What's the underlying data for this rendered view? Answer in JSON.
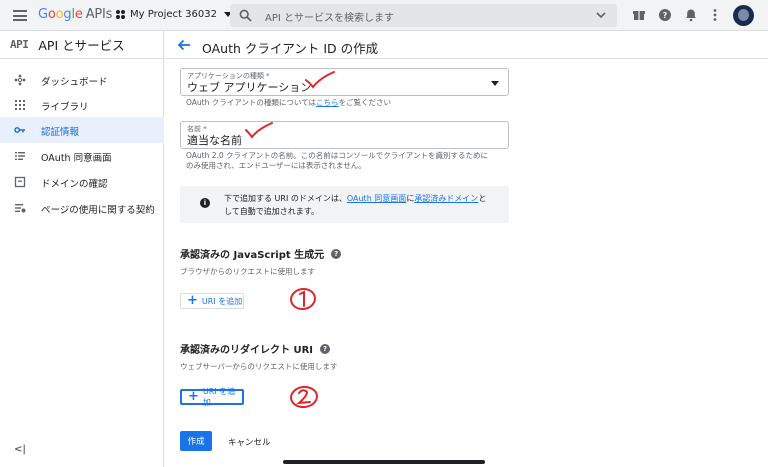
{
  "topbar": {
    "logo_parts": [
      "G",
      "o",
      "o",
      "g",
      "l",
      "e"
    ],
    "logo_suffix": "APIs",
    "project_name": "My Project 36032",
    "search_placeholder": "API とサービスを検索します",
    "icons": [
      "menu-icon",
      "project-dots-icon",
      "search-icon",
      "chevron-down-icon",
      "gift-icon",
      "help-icon",
      "bell-icon",
      "more-vert-icon",
      "avatar"
    ]
  },
  "sidebar": {
    "logo": "API",
    "title": "API とサービス",
    "items": [
      {
        "label": "ダッシュボード",
        "icon": "dashboard-icon",
        "active": false
      },
      {
        "label": "ライブラリ",
        "icon": "library-icon",
        "active": false
      },
      {
        "label": "認証情報",
        "icon": "key-icon",
        "active": true
      },
      {
        "label": "OAuth 同意画面",
        "icon": "consent-icon",
        "active": false
      },
      {
        "label": "ドメインの確認",
        "icon": "domain-check-icon",
        "active": false
      },
      {
        "label": "ページの使用に関する契約",
        "icon": "page-settings-icon",
        "active": false
      }
    ],
    "collapse_label": "<|"
  },
  "header": {
    "title": "OAuth クライアント ID の作成"
  },
  "form": {
    "app_type": {
      "label": "アプリケーションの種類 *",
      "value": "ウェブ アプリケーション",
      "hint_prefix": "OAuth クライアントの種類については",
      "hint_link": "こちら",
      "hint_suffix": "をご覧ください"
    },
    "name": {
      "label": "名前 *",
      "value": "適当な名前",
      "hint_line1": "OAuth 2.0 クライアントの名前。この名前はコンソールでクライアントを識別するために",
      "hint_line2": "のみ使用され、エンドユーザーには表示されません。"
    },
    "info": {
      "text1": "下で追加する URI のドメインは、",
      "link1": "OAuth 同意画面",
      "text2": "に",
      "link2": "承認済みドメイン",
      "text3": "と",
      "text4": "して自動で追加されます。"
    },
    "js_origins": {
      "title": "承認済みの JavaScript 生成元",
      "desc": "ブラウザからのリクエストに使用します",
      "button": "URI を追加"
    },
    "redirect_uris": {
      "title": "承認済みのリダイレクト URI",
      "desc": "ウェブサーバーからのリクエストに使用します",
      "button": "URI を追加"
    },
    "create_label": "作成",
    "cancel_label": "キャンセル"
  },
  "colors": {
    "accent": "#1a73e8",
    "active_bg": "#e8f0fe",
    "annotation_red": "#e0262a"
  }
}
